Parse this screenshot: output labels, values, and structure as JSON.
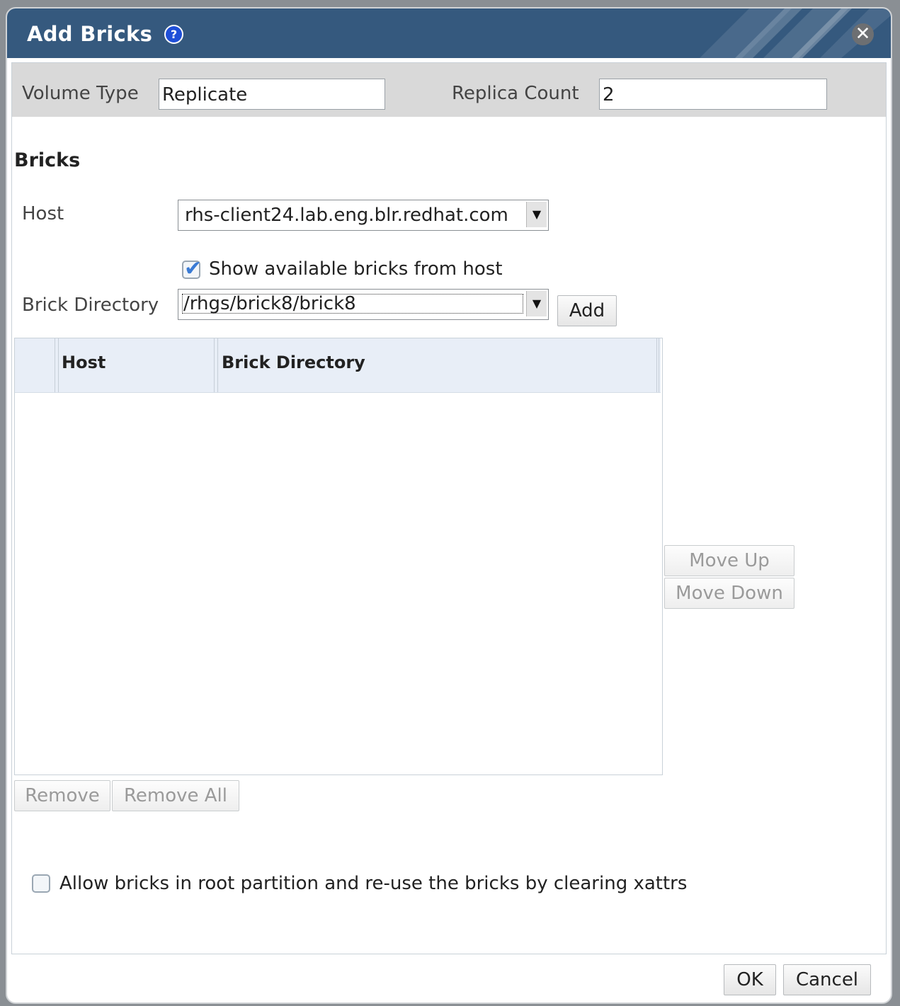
{
  "dialog": {
    "title": "Add Bricks",
    "help_icon": "?",
    "close_icon": "✕"
  },
  "volume": {
    "type_label": "Volume Type",
    "type_value": "Replicate",
    "replica_label": "Replica Count",
    "replica_value": "2"
  },
  "bricks": {
    "section_title": "Bricks",
    "host_label": "Host",
    "host_value": "rhs-client24.lab.eng.blr.redhat.com",
    "show_available_label": "Show available bricks from host",
    "show_available_checked": true,
    "brick_dir_label": "Brick Directory",
    "brick_dir_value": "/rhgs/brick8/brick8",
    "add_label": "Add"
  },
  "table": {
    "columns": [
      "Host",
      "Brick Directory"
    ],
    "rows": []
  },
  "buttons": {
    "move_up": "Move Up",
    "move_down": "Move Down",
    "remove": "Remove",
    "remove_all": "Remove All",
    "ok": "OK",
    "cancel": "Cancel"
  },
  "options": {
    "allow_root_label": "Allow bricks in root partition and re-use the bricks by clearing xattrs",
    "allow_root_checked": false
  },
  "colors": {
    "titlebar": "#35597e",
    "help_icon": "#1f4fd8",
    "checkbox_check": "#3a7bd5",
    "table_header": "#e8eef7"
  }
}
